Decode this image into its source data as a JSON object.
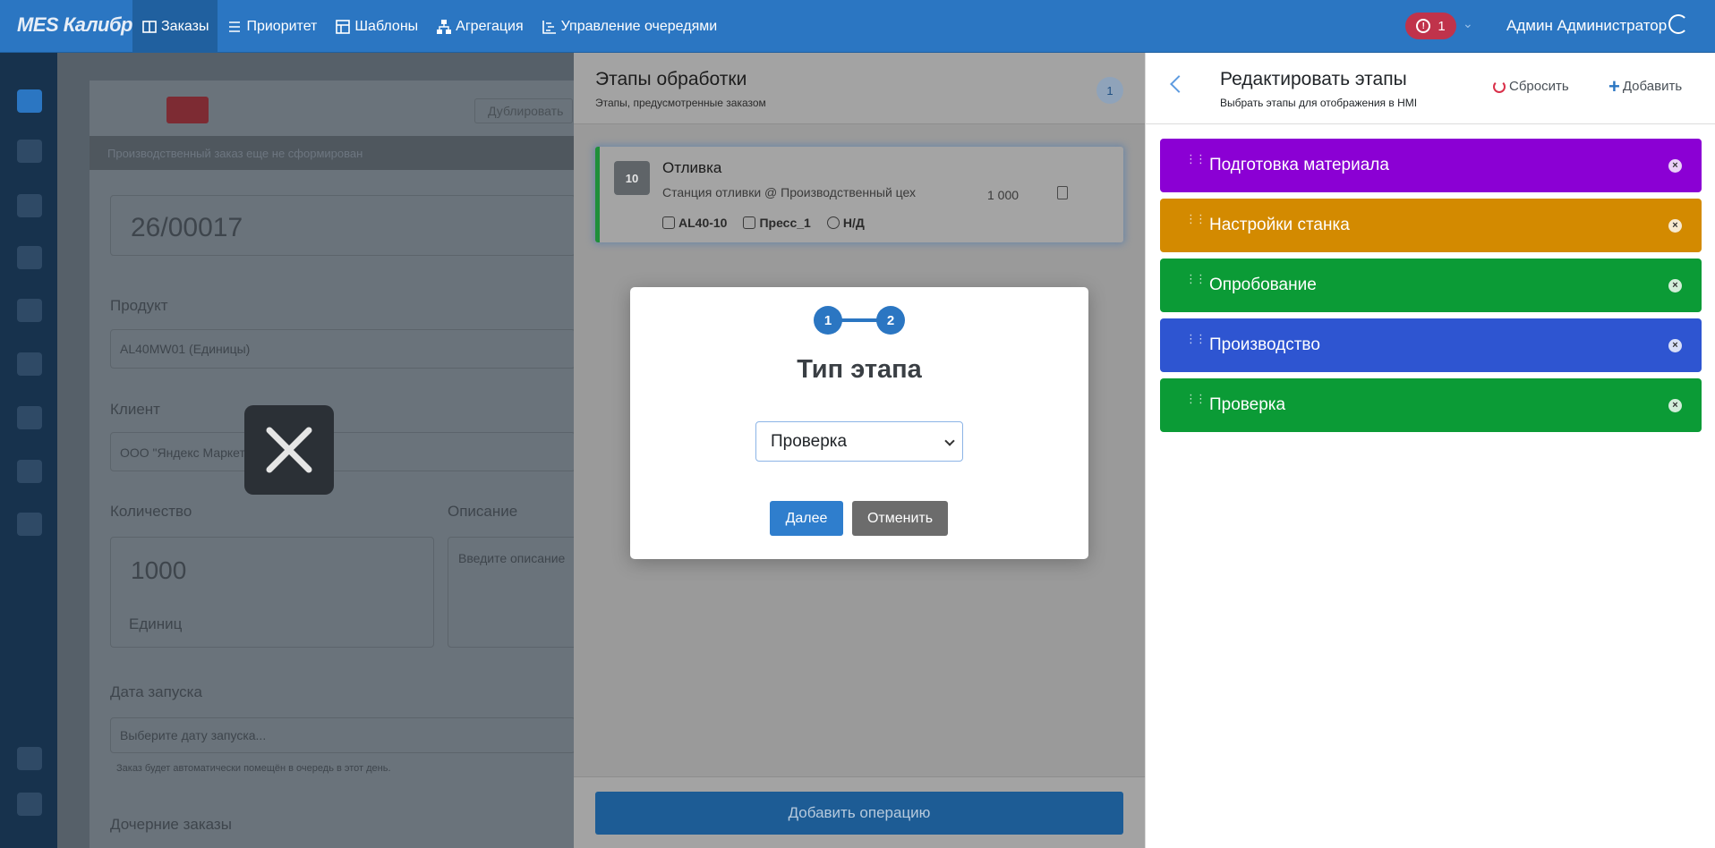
{
  "app": {
    "brand": "MES Калибр"
  },
  "nav": {
    "items": [
      {
        "label": "Заказы",
        "active": true
      },
      {
        "label": "Приоритет",
        "active": false
      },
      {
        "label": "Шаблоны",
        "active": false
      },
      {
        "label": "Агрегация",
        "active": false
      },
      {
        "label": "Управление очередями",
        "active": false
      }
    ],
    "alert_count": "1",
    "user_name": "Админ Администратор"
  },
  "background_form": {
    "duplicate_label": "Дублировать",
    "status_strip": "Производственный заказ еще не сформирован",
    "order_number": "26/00017",
    "product_label": "Продукт",
    "product_value": "AL40MW01 (Единицы)",
    "client_label": "Клиент",
    "client_value": "ООО \"Яндекс Маркет\"",
    "quantity_label": "Количество",
    "quantity_value": "1000",
    "unit_value": "Единиц",
    "description_label": "Описание",
    "description_placeholder": "Введите описание",
    "start_date_label": "Дата запуска",
    "start_date_placeholder": "Выберите дату запуска...",
    "start_date_hint": "Заказ будет автоматически помещён в очередь в этот день.",
    "child_orders_label": "Дочерние заказы"
  },
  "stages_panel": {
    "title": "Этапы обработки",
    "subtitle": "Этапы, предусмотренные заказом",
    "badge": "1",
    "operation": {
      "number": "10",
      "title": "Отливка",
      "subtitle": "Станция отливки @ Производственный цех",
      "quantity": "1 000",
      "tags": [
        {
          "icon": "box-icon",
          "label": "AL40-10"
        },
        {
          "icon": "press-icon",
          "label": "Пресс_1"
        },
        {
          "icon": "target-icon",
          "label": "Н/Д"
        }
      ]
    },
    "add_operation_label": "Добавить операцию"
  },
  "edit_panel": {
    "title": "Редактировать этапы",
    "subtitle": "Выбрать этапы для отображения в HMI",
    "reset_label": "Сбросить",
    "add_label": "Добавить",
    "stages": [
      {
        "label": "Подготовка материала",
        "color": "#8b00d4"
      },
      {
        "label": "Настройки станка",
        "color": "#d38a00"
      },
      {
        "label": "Опробование",
        "color": "#0b9b36"
      },
      {
        "label": "Производство",
        "color": "#2e55d1"
      },
      {
        "label": "Проверка",
        "color": "#0b9b36"
      }
    ]
  },
  "modal": {
    "steps": [
      "1",
      "2"
    ],
    "title": "Тип этапа",
    "selected_value": "Проверка",
    "next_label": "Далее",
    "cancel_label": "Отменить"
  }
}
